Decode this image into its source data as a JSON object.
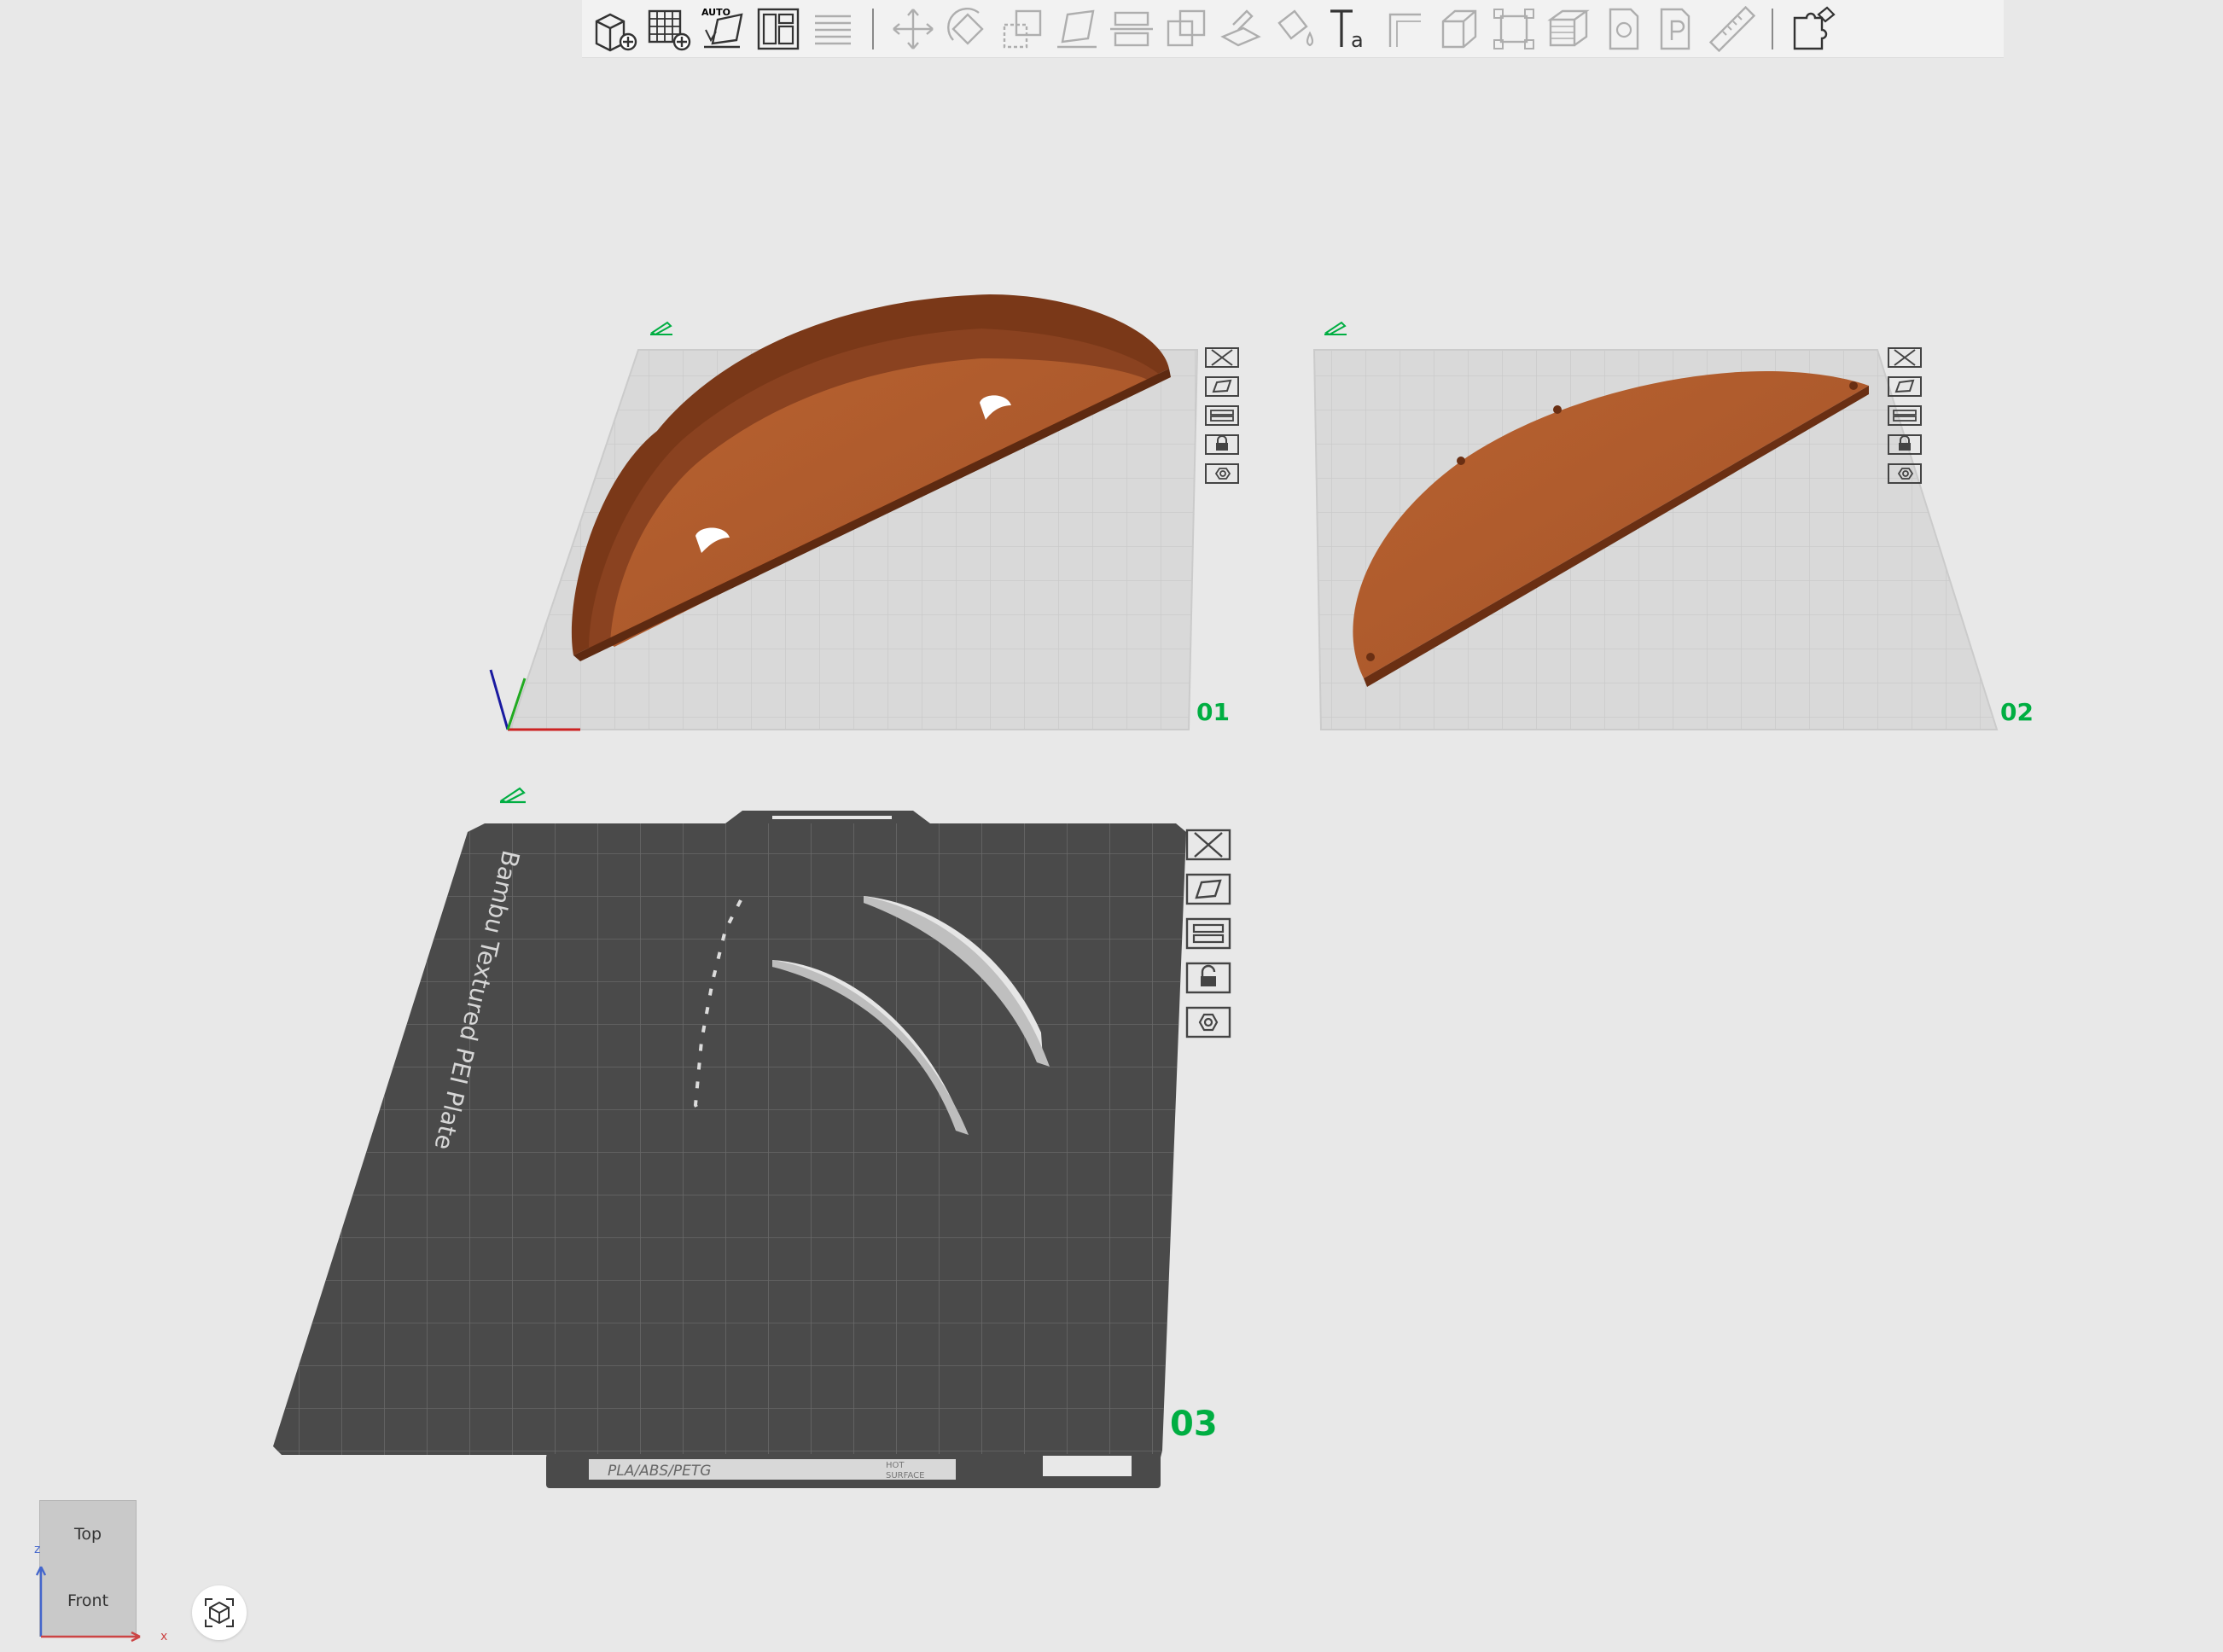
{
  "toolbar": {
    "auto_label": "AUTO",
    "items": [
      {
        "name": "add-object",
        "icon": "cube-plus-icon"
      },
      {
        "name": "add-plate",
        "icon": "grid-plus-icon"
      },
      {
        "name": "auto-orient",
        "icon": "auto-orient-icon"
      },
      {
        "name": "arrange",
        "icon": "arrange-icon"
      },
      {
        "name": "split-layers",
        "icon": "layers-lines-icon"
      },
      {
        "name": "move",
        "icon": "move-arrows-icon"
      },
      {
        "name": "rotate",
        "icon": "rotate-icon"
      },
      {
        "name": "scale",
        "icon": "scale-icon"
      },
      {
        "name": "lay-on-face",
        "icon": "lay-on-face-icon"
      },
      {
        "name": "cut",
        "icon": "cut-icon"
      },
      {
        "name": "boolean",
        "icon": "boolean-icon"
      },
      {
        "name": "support-paint",
        "icon": "support-paint-icon"
      },
      {
        "name": "color-paint",
        "icon": "color-paint-icon"
      },
      {
        "name": "text",
        "icon": "text-icon"
      },
      {
        "name": "seam",
        "icon": "seam-icon"
      },
      {
        "name": "fuzzy-skin",
        "icon": "box-icon"
      },
      {
        "name": "assembly",
        "icon": "assembly-icon"
      },
      {
        "name": "variable-layer",
        "icon": "stacked-layers-icon"
      },
      {
        "name": "brim-ears",
        "icon": "brim-icon"
      },
      {
        "name": "emboss",
        "icon": "emboss-icon"
      },
      {
        "name": "measure",
        "icon": "ruler-icon"
      },
      {
        "name": "puzzle",
        "icon": "puzzle-icon"
      }
    ]
  },
  "plates": [
    {
      "id": "01",
      "label": "01"
    },
    {
      "id": "02",
      "label": "02"
    },
    {
      "id": "03",
      "label": "03",
      "bed_text": "Bambu Textured PEI Plate",
      "tag_material": "PLA/ABS/PETG",
      "tag_hot_1": "HOT",
      "tag_hot_2": "SURFACE"
    }
  ],
  "view_cube": {
    "top": "Top",
    "front": "Front",
    "axis_x": "x",
    "axis_z": "z"
  },
  "colors": {
    "accent": "#00ae42",
    "model": "#b05a30",
    "model_dark": "#7a3818",
    "bed_light": "#d9d9d9",
    "bed_dark": "#4a4a4a"
  }
}
